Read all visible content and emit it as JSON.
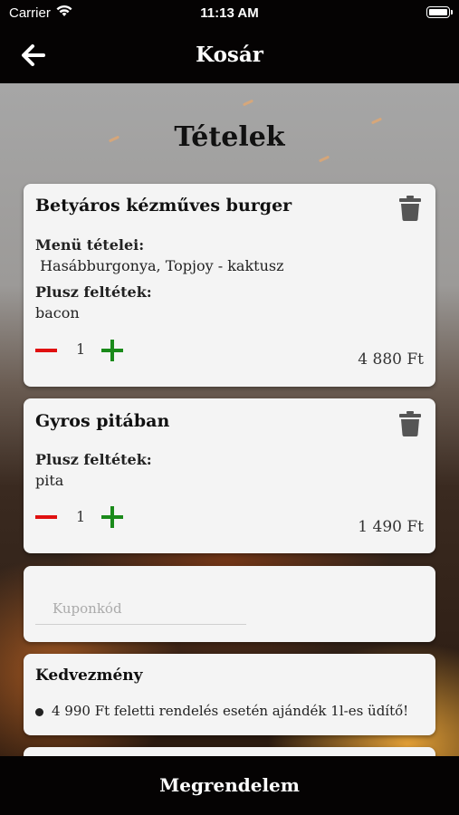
{
  "status_bar": {
    "carrier": "Carrier",
    "time": "11:13 AM"
  },
  "nav": {
    "title": "Kosár"
  },
  "section_title": "Tételek",
  "cart_items": [
    {
      "name": "Betyáros kézműves burger",
      "menu_label": "Menü tételei:",
      "menu_value": " Hasábburgonya, Topjoy - kaktusz",
      "extras_label": "Plusz feltétek:",
      "extras_value": "bacon",
      "quantity": "1",
      "price": "4 880 Ft"
    },
    {
      "name": "Gyros pitában",
      "extras_label": "Plusz feltétek:",
      "extras_value": "pita",
      "quantity": "1",
      "price": "1 490 Ft"
    }
  ],
  "coupon": {
    "placeholder": "Kuponkód",
    "value": ""
  },
  "discount": {
    "title": "Kedvezmény",
    "items": [
      "4 990 Ft feletti rendelés esetén ajándék 1l-es üdítő!"
    ]
  },
  "order_button": {
    "label": "Megrendelem"
  },
  "colors": {
    "minus": "#e01010",
    "plus": "#1a8a1a",
    "bar": "#050303",
    "card": "#f4f4f4"
  }
}
